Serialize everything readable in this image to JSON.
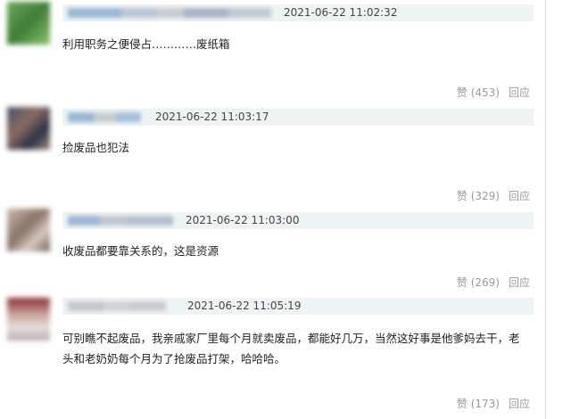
{
  "comments": [
    {
      "timestamp": "2021-06-22 11:02:32",
      "text": "利用职务之便侵占…………废纸箱",
      "like_label": "赞",
      "like_count": "(453)",
      "reply_label": "回应"
    },
    {
      "timestamp": "2021-06-22 11:03:17",
      "text": "捡废品也犯法",
      "like_label": "赞",
      "like_count": "(329)",
      "reply_label": "回应"
    },
    {
      "timestamp": "2021-06-22 11:03:00",
      "text": "收废品都要靠关系的，这是资源",
      "like_label": "赞",
      "like_count": "(269)",
      "reply_label": "回应"
    },
    {
      "timestamp": "2021-06-22 11:05:19",
      "text": "可别瞧不起废品，我亲戚家厂里每个月就卖废品，都能好几万，当然这好事是他爹妈去干，老头和老奶奶每个月为了抢废品打架，哈哈哈。",
      "like_label": "赞",
      "like_count": "(173)",
      "reply_label": "回应"
    }
  ],
  "colors": {
    "meta_bar_bg": "#eef4f4",
    "text": "#222222",
    "muted": "#9a9a9a"
  }
}
